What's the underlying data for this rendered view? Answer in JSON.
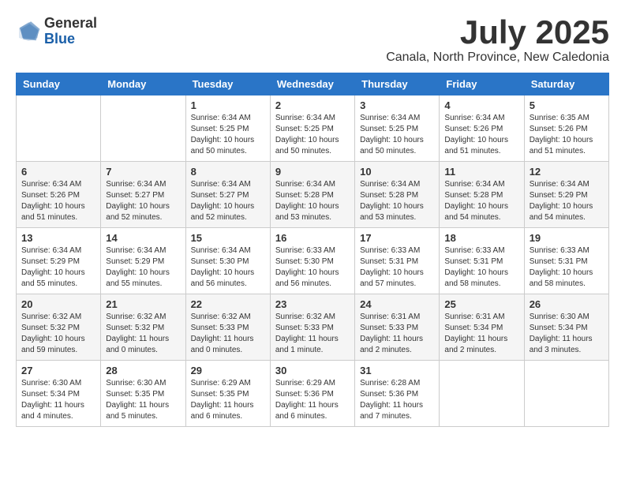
{
  "logo": {
    "general": "General",
    "blue": "Blue"
  },
  "title": {
    "month_year": "July 2025",
    "location": "Canala, North Province, New Caledonia"
  },
  "weekdays": [
    "Sunday",
    "Monday",
    "Tuesday",
    "Wednesday",
    "Thursday",
    "Friday",
    "Saturday"
  ],
  "weeks": [
    [
      {
        "day": "",
        "info": ""
      },
      {
        "day": "",
        "info": ""
      },
      {
        "day": "1",
        "info": "Sunrise: 6:34 AM\nSunset: 5:25 PM\nDaylight: 10 hours and 50 minutes."
      },
      {
        "day": "2",
        "info": "Sunrise: 6:34 AM\nSunset: 5:25 PM\nDaylight: 10 hours and 50 minutes."
      },
      {
        "day": "3",
        "info": "Sunrise: 6:34 AM\nSunset: 5:25 PM\nDaylight: 10 hours and 50 minutes."
      },
      {
        "day": "4",
        "info": "Sunrise: 6:34 AM\nSunset: 5:26 PM\nDaylight: 10 hours and 51 minutes."
      },
      {
        "day": "5",
        "info": "Sunrise: 6:35 AM\nSunset: 5:26 PM\nDaylight: 10 hours and 51 minutes."
      }
    ],
    [
      {
        "day": "6",
        "info": "Sunrise: 6:34 AM\nSunset: 5:26 PM\nDaylight: 10 hours and 51 minutes."
      },
      {
        "day": "7",
        "info": "Sunrise: 6:34 AM\nSunset: 5:27 PM\nDaylight: 10 hours and 52 minutes."
      },
      {
        "day": "8",
        "info": "Sunrise: 6:34 AM\nSunset: 5:27 PM\nDaylight: 10 hours and 52 minutes."
      },
      {
        "day": "9",
        "info": "Sunrise: 6:34 AM\nSunset: 5:28 PM\nDaylight: 10 hours and 53 minutes."
      },
      {
        "day": "10",
        "info": "Sunrise: 6:34 AM\nSunset: 5:28 PM\nDaylight: 10 hours and 53 minutes."
      },
      {
        "day": "11",
        "info": "Sunrise: 6:34 AM\nSunset: 5:28 PM\nDaylight: 10 hours and 54 minutes."
      },
      {
        "day": "12",
        "info": "Sunrise: 6:34 AM\nSunset: 5:29 PM\nDaylight: 10 hours and 54 minutes."
      }
    ],
    [
      {
        "day": "13",
        "info": "Sunrise: 6:34 AM\nSunset: 5:29 PM\nDaylight: 10 hours and 55 minutes."
      },
      {
        "day": "14",
        "info": "Sunrise: 6:34 AM\nSunset: 5:29 PM\nDaylight: 10 hours and 55 minutes."
      },
      {
        "day": "15",
        "info": "Sunrise: 6:34 AM\nSunset: 5:30 PM\nDaylight: 10 hours and 56 minutes."
      },
      {
        "day": "16",
        "info": "Sunrise: 6:33 AM\nSunset: 5:30 PM\nDaylight: 10 hours and 56 minutes."
      },
      {
        "day": "17",
        "info": "Sunrise: 6:33 AM\nSunset: 5:31 PM\nDaylight: 10 hours and 57 minutes."
      },
      {
        "day": "18",
        "info": "Sunrise: 6:33 AM\nSunset: 5:31 PM\nDaylight: 10 hours and 58 minutes."
      },
      {
        "day": "19",
        "info": "Sunrise: 6:33 AM\nSunset: 5:31 PM\nDaylight: 10 hours and 58 minutes."
      }
    ],
    [
      {
        "day": "20",
        "info": "Sunrise: 6:32 AM\nSunset: 5:32 PM\nDaylight: 10 hours and 59 minutes."
      },
      {
        "day": "21",
        "info": "Sunrise: 6:32 AM\nSunset: 5:32 PM\nDaylight: 11 hours and 0 minutes."
      },
      {
        "day": "22",
        "info": "Sunrise: 6:32 AM\nSunset: 5:33 PM\nDaylight: 11 hours and 0 minutes."
      },
      {
        "day": "23",
        "info": "Sunrise: 6:32 AM\nSunset: 5:33 PM\nDaylight: 11 hours and 1 minute."
      },
      {
        "day": "24",
        "info": "Sunrise: 6:31 AM\nSunset: 5:33 PM\nDaylight: 11 hours and 2 minutes."
      },
      {
        "day": "25",
        "info": "Sunrise: 6:31 AM\nSunset: 5:34 PM\nDaylight: 11 hours and 2 minutes."
      },
      {
        "day": "26",
        "info": "Sunrise: 6:30 AM\nSunset: 5:34 PM\nDaylight: 11 hours and 3 minutes."
      }
    ],
    [
      {
        "day": "27",
        "info": "Sunrise: 6:30 AM\nSunset: 5:34 PM\nDaylight: 11 hours and 4 minutes."
      },
      {
        "day": "28",
        "info": "Sunrise: 6:30 AM\nSunset: 5:35 PM\nDaylight: 11 hours and 5 minutes."
      },
      {
        "day": "29",
        "info": "Sunrise: 6:29 AM\nSunset: 5:35 PM\nDaylight: 11 hours and 6 minutes."
      },
      {
        "day": "30",
        "info": "Sunrise: 6:29 AM\nSunset: 5:36 PM\nDaylight: 11 hours and 6 minutes."
      },
      {
        "day": "31",
        "info": "Sunrise: 6:28 AM\nSunset: 5:36 PM\nDaylight: 11 hours and 7 minutes."
      },
      {
        "day": "",
        "info": ""
      },
      {
        "day": "",
        "info": ""
      }
    ]
  ]
}
